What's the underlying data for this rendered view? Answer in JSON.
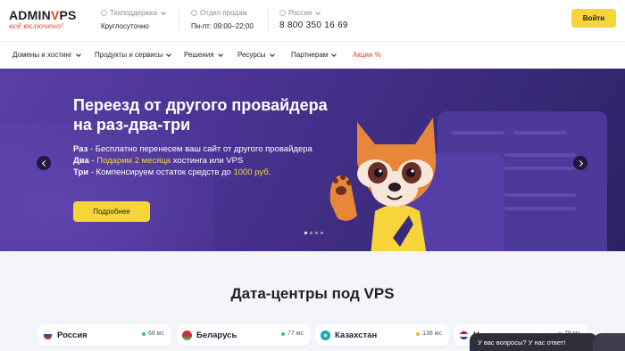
{
  "header": {
    "logo_text_left": "ADMIN",
    "logo_v": "V",
    "logo_text_right": "PS",
    "logo_tagline": "всё включено!",
    "support": {
      "label": "Техподдержка",
      "value": "Круглосуточно"
    },
    "sales": {
      "label": "Отдел продаж",
      "value": "Пн-пт: 09:00–22:00"
    },
    "region": {
      "label": "Россия",
      "value": "8 800 350 16 69"
    },
    "login_label": "Войти"
  },
  "nav": {
    "items": [
      {
        "label": "Домены и хостинг"
      },
      {
        "label": "Продукты и сервисы"
      },
      {
        "label": "Решения"
      },
      {
        "label": "Ресурсы"
      },
      {
        "label": "Партнерам"
      }
    ],
    "promo_label": "Акции %"
  },
  "banner": {
    "title": "Переезд от другого провайдера на раз-два-три",
    "line1_key": "Раз",
    "line1_text": " - Бесплатно перенесем ваш сайт от другого провайдера",
    "line2_key": "Два",
    "line2_sep": " - ",
    "line2_hl": "Подарим 2 месяца",
    "line2_text": " хостинга или VPS",
    "line3_key": "Три",
    "line3_text": " - Компенсируем остаток средств до ",
    "line3_hl": "1000 руб.",
    "button_label": "Подробнее",
    "slides_total": 4,
    "slide_active": 1
  },
  "datacenters": {
    "title": "Дата-центры под VPS",
    "items": [
      {
        "name": "Россия",
        "ping": "68 мс",
        "ping_color": "#3cc46b"
      },
      {
        "name": "Беларусь",
        "ping": "77 мс",
        "ping_color": "#3cc46b"
      },
      {
        "name": "Казахстан",
        "ping": "138 мс",
        "ping_color": "#f2b531"
      },
      {
        "name": "Н",
        "ping": "79 мс",
        "ping_color": "#3cc46b"
      }
    ]
  },
  "chat": {
    "label": "У вас вопросы? У нас ответ!"
  },
  "colors": {
    "accent": "#f7d43a",
    "brand_red": "#e0412f",
    "banner_bg": "#4a3393"
  }
}
